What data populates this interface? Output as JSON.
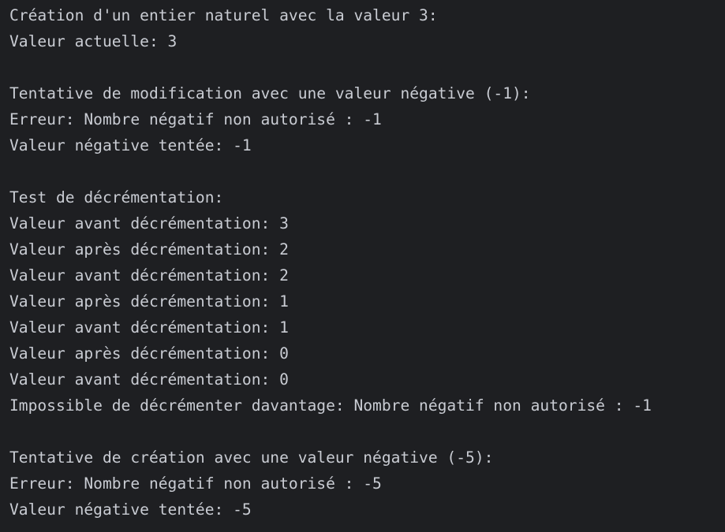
{
  "console": {
    "lines": [
      "Création d'un entier naturel avec la valeur 3:",
      "Valeur actuelle: 3",
      "",
      "Tentative de modification avec une valeur négative (-1):",
      "Erreur: Nombre négatif non autorisé : -1",
      "Valeur négative tentée: -1",
      "",
      "Test de décrémentation:",
      "Valeur avant décrémentation: 3",
      "Valeur après décrémentation: 2",
      "Valeur avant décrémentation: 2",
      "Valeur après décrémentation: 1",
      "Valeur avant décrémentation: 1",
      "Valeur après décrémentation: 0",
      "Valeur avant décrémentation: 0",
      "Impossible de décrémenter davantage: Nombre négatif non autorisé : -1",
      "",
      "Tentative de création avec une valeur négative (-5):",
      "Erreur: Nombre négatif non autorisé : -5",
      "Valeur négative tentée: -5"
    ]
  },
  "colors": {
    "background": "#1e1f22",
    "text": "#c9ccd3"
  }
}
